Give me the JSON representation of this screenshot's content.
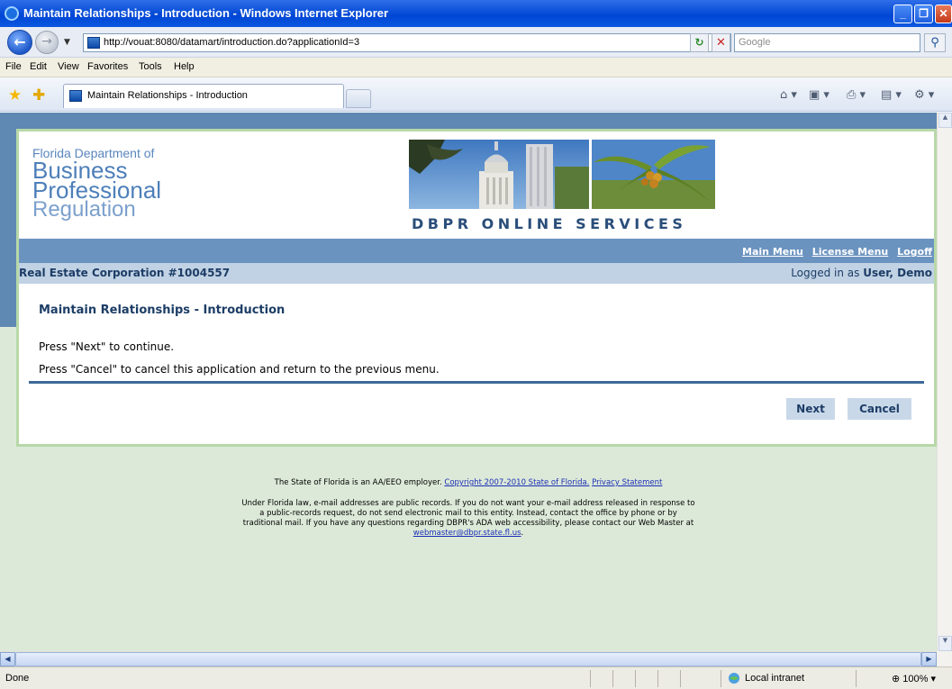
{
  "browser": {
    "title": "Maintain Relationships - Introduction - Windows Internet Explorer",
    "url": "http://vouat:8080/datamart/introduction.do?applicationId=3",
    "search_placeholder": "Google",
    "menu": [
      "File",
      "Edit",
      "View",
      "Favorites",
      "Tools",
      "Help"
    ],
    "tab_title": "Maintain Relationships - Introduction",
    "status": "Done",
    "zone": "Local intranet",
    "zoom": "100%"
  },
  "header": {
    "logo_line1": "Florida Department of",
    "logo_line2": "Business",
    "logo_line3": "Professional",
    "logo_line4": "Regulation",
    "banner_caption": "DBPR ONLINE SERVICES"
  },
  "nav": {
    "main_menu": "Main Menu",
    "license_menu": "License Menu",
    "logoff": "Logoff"
  },
  "entity": {
    "name": "Real Estate Corporation #1004557",
    "logged_in_prefix": "Logged in as ",
    "user": "User, Demo"
  },
  "main": {
    "title": "Maintain Relationships - Introduction",
    "instruction1": "Press \"Next\" to continue.",
    "instruction2": "Press \"Cancel\" to cancel this application and return to the previous menu.",
    "next_label": "Next",
    "cancel_label": "Cancel"
  },
  "footer": {
    "line1_prefix": "The State of Florida is an AA/EEO employer.",
    "copyright_link": "Copyright 2007-2010 State of Florida.",
    "privacy_link": "Privacy Statement",
    "para_line1": "Under Florida law, e-mail addresses are public records. If you do not want your e-mail address released in response to",
    "para_line2": "a public-records request, do not send electronic mail to this entity. Instead, contact the office by phone or by",
    "para_line3": "traditional mail. If you have any questions regarding DBPR's ADA web accessibility, please contact our Web Master at",
    "webmaster_link": "webmaster@dbpr.state.fl.us",
    "webmaster_suffix": "."
  },
  "colors": {
    "title_blue": "#1c3d66",
    "nav_strip": "#6b93bf",
    "entity_bar": "#c1d2e4",
    "page_bg": "#dce9d8",
    "button_bg": "#c9d8e9"
  }
}
